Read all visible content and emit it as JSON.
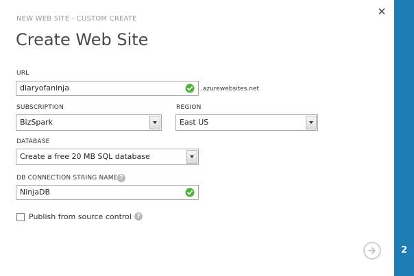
{
  "dialog": {
    "subtitle": "NEW WEB SITE - CUSTOM CREATE",
    "title": "Create Web Site",
    "step_number": "2"
  },
  "url": {
    "label": "URL",
    "value": "diaryofaninja",
    "suffix": ".azurewebsites.net"
  },
  "subscription": {
    "label": "SUBSCRIPTION",
    "selected": "BizSpark"
  },
  "region": {
    "label": "REGION",
    "selected": "East US"
  },
  "database": {
    "label": "DATABASE",
    "selected": "Create a free 20 MB SQL database"
  },
  "connection": {
    "label": "DB CONNECTION STRING NAME",
    "value": "NinjaDB"
  },
  "publish": {
    "label": "Publish from source control",
    "checked": false
  },
  "icons": {
    "close": "close-icon",
    "valid": "check-circle-icon",
    "help": "help-icon",
    "next": "arrow-right-icon"
  },
  "colors": {
    "accent": "#1e7db4",
    "valid_green": "#4fb234"
  }
}
